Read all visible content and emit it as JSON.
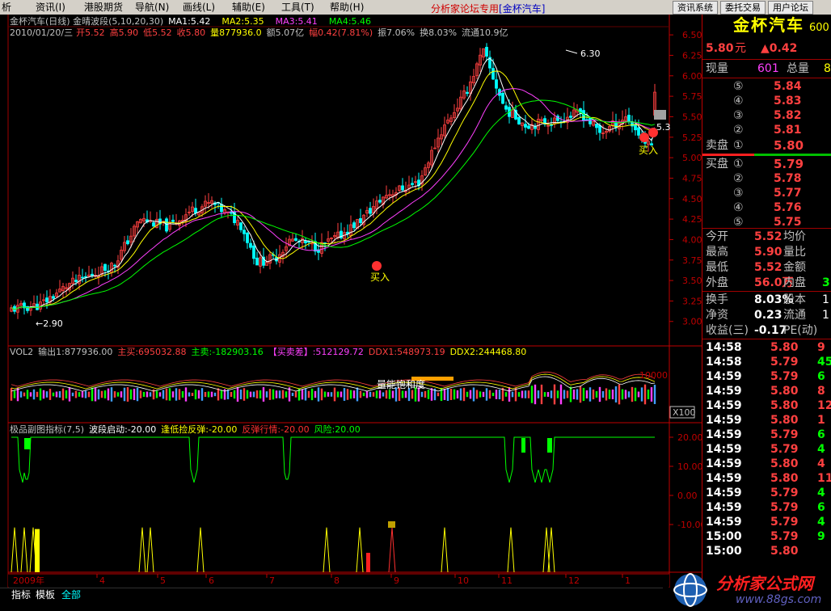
{
  "menu": {
    "items": [
      "析",
      "资讯(I)",
      "港股期货",
      "导航(N)",
      "画线(L)",
      "辅助(E)",
      "工具(T)",
      "帮助(H)"
    ],
    "center_title": "分析家论坛专用",
    "center_stock": "[金杯汽车]",
    "right_buttons": [
      "资讯系统",
      "委托交易",
      "用户论坛"
    ]
  },
  "main_chart": {
    "title_prefix": "金杯汽车(日线) 金晴波段(5,10,20,30)",
    "ma": [
      {
        "label": "MA1:5.42",
        "color": "#ffffff"
      },
      {
        "label": "MA2:5.35",
        "color": "#ffff00"
      },
      {
        "label": "MA3:5.41",
        "color": "#ff40ff"
      },
      {
        "label": "MA4:5.46",
        "color": "#00ff00"
      }
    ],
    "date": "2010/01/20/三",
    "info": [
      {
        "text": "开5.52",
        "color": "#ff4040"
      },
      {
        "text": "高5.90",
        "color": "#ff4040"
      },
      {
        "text": "低5.52",
        "color": "#ff4040"
      },
      {
        "text": "收5.80",
        "color": "#ff4040"
      },
      {
        "text": "量877936.0",
        "color": "#ffff00"
      },
      {
        "text": "额5.07亿",
        "color": "#c0c0c0"
      },
      {
        "text": "幅0.42(7.81%)",
        "color": "#ff4040"
      },
      {
        "text": "振7.06%",
        "color": "#c0c0c0"
      },
      {
        "text": "换8.03%",
        "color": "#c0c0c0"
      },
      {
        "text": "流通10.9亿",
        "color": "#c0c0c0"
      }
    ],
    "high_marker": "6.30",
    "low_marker": "←2.90",
    "buy_label": "买入",
    "last_marker": "5.3"
  },
  "vol_panel": {
    "title": "VOL2",
    "items": [
      {
        "text": "输出1:877936.00",
        "color": "#c0c0c0"
      },
      {
        "text": "主买:695032.88",
        "color": "#ff4040"
      },
      {
        "text": "主卖:-182903.16",
        "color": "#00ff00"
      },
      {
        "text": "【买卖差】:512129.72",
        "color": "#ff40ff"
      },
      {
        "text": "DDX1:548973.19",
        "color": "#ff4040"
      },
      {
        "text": "DDX2:244468.80",
        "color": "#ffff00"
      }
    ],
    "annotation": "量能饱和度",
    "axis_label": "10000",
    "scale": "X100"
  },
  "ind_panel": {
    "title": "极品副图指标(7,5)",
    "items": [
      {
        "text": "波段启动:-20.00",
        "color": "#ffffff"
      },
      {
        "text": "逢低捡反弹:-20.00",
        "color": "#ffff00"
      },
      {
        "text": "反弹行情:-20.00",
        "color": "#ff3030"
      },
      {
        "text": "风险:20.00",
        "color": "#00ff00"
      }
    ],
    "axis": [
      "20.00",
      "10.00",
      "0.00",
      "-10.00"
    ]
  },
  "price_axis": [
    "6.50",
    "6.25",
    "6.00",
    "5.75",
    "5.50",
    "5.25",
    "5.00",
    "4.75",
    "4.50",
    "4.25",
    "4.00",
    "3.75",
    "3.50",
    "3.25",
    "3.00"
  ],
  "time_axis": {
    "year": "2009年",
    "months": [
      "4",
      "5",
      "6",
      "7",
      "8",
      "9",
      "10",
      "11",
      "12",
      "1"
    ]
  },
  "tabs": [
    "指标",
    "模板",
    "全部"
  ],
  "quote": {
    "name": "金杯汽车",
    "code": "600",
    "price": "5.80",
    "unit": "元",
    "change": "▲0.42",
    "now_vol_label": "现量",
    "now_vol": "601",
    "total_vol_label": "总量",
    "total_vol": "8",
    "asks": [
      {
        "lvl": "⑤",
        "price": "5.84"
      },
      {
        "lvl": "④",
        "price": "5.83"
      },
      {
        "lvl": "③",
        "price": "5.82"
      },
      {
        "lvl": "②",
        "price": "5.81"
      }
    ],
    "ask1_label": "卖盘",
    "ask1_lvl": "①",
    "ask1_price": "5.80",
    "bid1_label": "买盘",
    "bid1_lvl": "①",
    "bid1_price": "5.79",
    "bids": [
      {
        "lvl": "②",
        "price": "5.78"
      },
      {
        "lvl": "③",
        "price": "5.77"
      },
      {
        "lvl": "④",
        "price": "5.76"
      },
      {
        "lvl": "⑤",
        "price": "5.75"
      }
    ],
    "stats": [
      {
        "l1": "今开",
        "v1": "5.52",
        "c1": "#ff4040",
        "l2": "均价"
      },
      {
        "l1": "最高",
        "v1": "5.90",
        "c1": "#ff4040",
        "l2": "量比"
      },
      {
        "l1": "最低",
        "v1": "5.52",
        "c1": "#ff4040",
        "l2": "金额"
      },
      {
        "l1": "外盘",
        "v1": "56.0万",
        "c1": "#ff4040",
        "l2": "内盘",
        "v2": "3",
        "c2": "#00ff00"
      }
    ],
    "stats2": [
      {
        "l1": "换手",
        "v1": "8.03%",
        "l2": "股本",
        "v2": "1"
      },
      {
        "l1": "净资",
        "v1": "0.23",
        "l2": "流通",
        "v2": "1"
      },
      {
        "l1": "收益(三)",
        "v1": "-0.17",
        "l2": "PE(动)",
        "v2": ""
      }
    ]
  },
  "ticks": [
    {
      "t": "14:58",
      "p": "5.80",
      "v": "9",
      "vc": "#ff4040"
    },
    {
      "t": "14:58",
      "p": "5.79",
      "v": "45",
      "vc": "#00ff00"
    },
    {
      "t": "14:59",
      "p": "5.79",
      "v": "6",
      "vc": "#00ff00"
    },
    {
      "t": "14:59",
      "p": "5.80",
      "v": "8",
      "vc": "#ff4040"
    },
    {
      "t": "14:59",
      "p": "5.80",
      "v": "12",
      "vc": "#ff4040"
    },
    {
      "t": "14:59",
      "p": "5.80",
      "v": "1",
      "vc": "#ff4040"
    },
    {
      "t": "14:59",
      "p": "5.79",
      "v": "6",
      "vc": "#00ff00"
    },
    {
      "t": "14:59",
      "p": "5.79",
      "v": "4",
      "vc": "#00ff00"
    },
    {
      "t": "14:59",
      "p": "5.80",
      "v": "4",
      "vc": "#ff4040"
    },
    {
      "t": "14:59",
      "p": "5.80",
      "v": "11",
      "vc": "#ff4040"
    },
    {
      "t": "14:59",
      "p": "5.79",
      "v": "4",
      "vc": "#00ff00"
    },
    {
      "t": "14:59",
      "p": "5.79",
      "v": "6",
      "vc": "#00ff00"
    },
    {
      "t": "14:59",
      "p": "5.79",
      "v": "4",
      "vc": "#00ff00"
    },
    {
      "t": "15:00",
      "p": "5.79",
      "v": "9",
      "vc": "#00ff00"
    },
    {
      "t": "15:00",
      "p": "5.80",
      "v": "",
      "vc": "#ff4040"
    }
  ],
  "watermark": {
    "text": "分析家公式网",
    "url": "www.88gs.com"
  },
  "colors": {
    "up": "#ff4040",
    "down": "#00ffff",
    "bg": "#000000",
    "grid": "#800000"
  }
}
